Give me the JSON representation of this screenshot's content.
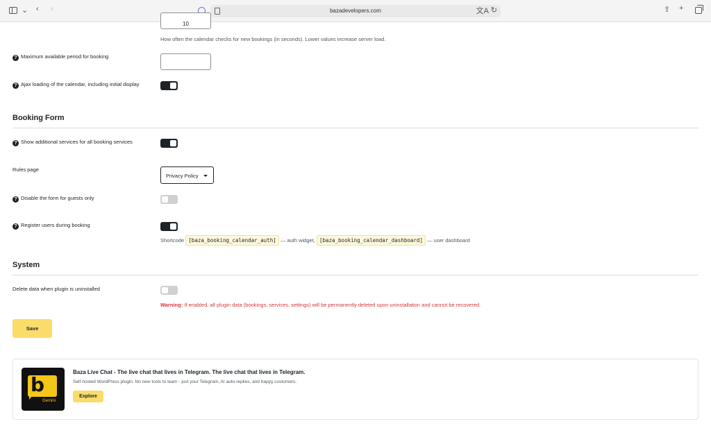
{
  "browser": {
    "url": "bazadevelopers.com"
  },
  "calendar": {
    "check_interval_value": "10",
    "check_interval_desc": "How often the calendar checks for new bookings (in seconds). Lower values increase server load.",
    "max_period_label": "Maximum available period for booking",
    "max_period_value": "",
    "ajax_label": "Ajax loading of the calendar, including initial display",
    "ajax_enabled": true
  },
  "booking_form": {
    "heading": "Booking Form",
    "additional_services_label": "Show additional services for all booking services",
    "additional_services_enabled": true,
    "rules_page_label": "Rules page",
    "rules_page_value": "Privacy Policy",
    "disable_guests_label": "Disable the form for guests only",
    "disable_guests_enabled": false,
    "register_users_label": "Register users during booking",
    "register_users_enabled": true,
    "shortcode_prefix": "Shortcode",
    "shortcode_auth": "[baza_booking_calendar_auth]",
    "shortcode_auth_suffix": "— auth widget,",
    "shortcode_dashboard": "[baza_booking_calendar_dashboard]",
    "shortcode_dashboard_suffix": "— user dashboard"
  },
  "system": {
    "heading": "System",
    "delete_data_label": "Delete data when plugin is uninstalled",
    "delete_data_enabled": false,
    "warning_label": "Warning:",
    "warning_text": "If enabled, all plugin data (bookings, services, settings) will be permanently deleted upon uninstallation and cannot be recovered."
  },
  "save_label": "Save",
  "promo": {
    "title": "Baza Live Chat - The live chat that lives in Telegram. The live chat that lives in Telegram.",
    "description": "Self-hosted WordPress plugin. No new tools to learn - just your Telegram, AI auto-replies, and happy customers.",
    "logo_text": "Gemini",
    "button_label": "Explore"
  },
  "colors": {
    "accent": "#fbdc6a",
    "toggle_on": "#1d2327",
    "warning": "#d63638"
  }
}
